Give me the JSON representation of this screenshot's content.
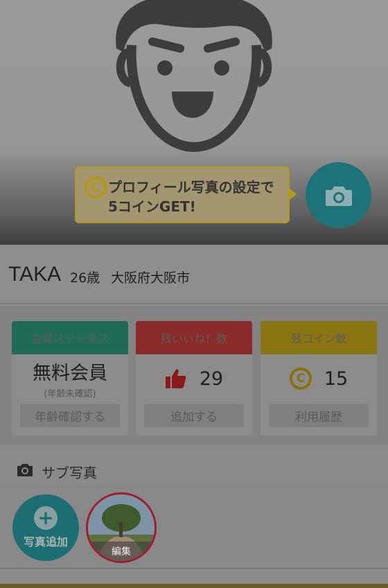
{
  "tooltip": {
    "coin_symbol": "C",
    "text": "プロフィール写真の設定で\n5コインGET!"
  },
  "profile": {
    "name": "TAKA",
    "age": "26歳",
    "city": "大阪府大阪市"
  },
  "cards": {
    "membership": {
      "title": "会員ステータス",
      "value": "無料会員",
      "sub": "(年齢未確認)",
      "action": "年齢確認する",
      "color": "#1f6b58"
    },
    "likes": {
      "title": "残いいね！数",
      "value": "29",
      "icon": "thumbs-up-icon",
      "action": "追加する",
      "color": "#8a2a2a"
    },
    "coins": {
      "title": "残コイン数",
      "value": "15",
      "icon": "coin-icon",
      "coin_symbol": "C",
      "action": "利用履歴",
      "color": "#8a7512"
    }
  },
  "sub_photos": {
    "title": "サブ写真",
    "add_label": "写真追加",
    "add_symbol": "+",
    "edit_label": "編集"
  },
  "colors": {
    "teal": "#1d7377",
    "gold": "#b29a1e",
    "red": "#a01c2c"
  }
}
